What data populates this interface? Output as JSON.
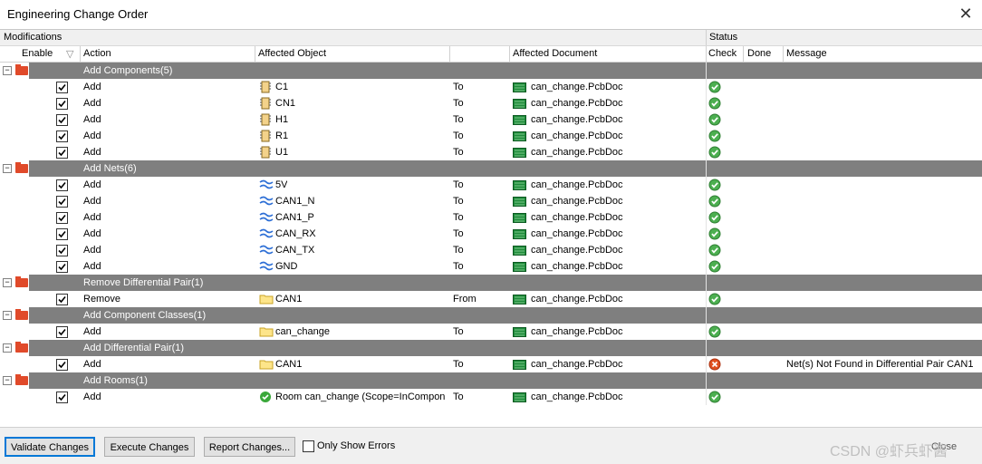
{
  "window": {
    "title": "Engineering Change Order",
    "close_icon": "close-icon"
  },
  "headers": {
    "modifications": "Modifications",
    "status": "Status",
    "enable": "Enable",
    "action": "Action",
    "affected_object": "Affected Object",
    "affected_document": "Affected Document",
    "check": "Check",
    "done": "Done",
    "message": "Message"
  },
  "groups": [
    {
      "label": "Add Components(5)",
      "rows": [
        {
          "action": "Add",
          "object": "C1",
          "object_icon": "component-icon",
          "dir": "To",
          "doc": "can_change.PcbDoc",
          "check": "ok",
          "message": ""
        },
        {
          "action": "Add",
          "object": "CN1",
          "object_icon": "component-icon",
          "dir": "To",
          "doc": "can_change.PcbDoc",
          "check": "ok",
          "message": ""
        },
        {
          "action": "Add",
          "object": "H1",
          "object_icon": "component-icon",
          "dir": "To",
          "doc": "can_change.PcbDoc",
          "check": "ok",
          "message": ""
        },
        {
          "action": "Add",
          "object": "R1",
          "object_icon": "component-icon",
          "dir": "To",
          "doc": "can_change.PcbDoc",
          "check": "ok",
          "message": ""
        },
        {
          "action": "Add",
          "object": "U1",
          "object_icon": "component-icon",
          "dir": "To",
          "doc": "can_change.PcbDoc",
          "check": "ok",
          "message": ""
        }
      ]
    },
    {
      "label": "Add Nets(6)",
      "rows": [
        {
          "action": "Add",
          "object": "5V",
          "object_icon": "net-icon",
          "dir": "To",
          "doc": "can_change.PcbDoc",
          "check": "ok",
          "message": ""
        },
        {
          "action": "Add",
          "object": "CAN1_N",
          "object_icon": "net-icon",
          "dir": "To",
          "doc": "can_change.PcbDoc",
          "check": "ok",
          "message": ""
        },
        {
          "action": "Add",
          "object": "CAN1_P",
          "object_icon": "net-icon",
          "dir": "To",
          "doc": "can_change.PcbDoc",
          "check": "ok",
          "message": ""
        },
        {
          "action": "Add",
          "object": "CAN_RX",
          "object_icon": "net-icon",
          "dir": "To",
          "doc": "can_change.PcbDoc",
          "check": "ok",
          "message": ""
        },
        {
          "action": "Add",
          "object": "CAN_TX",
          "object_icon": "net-icon",
          "dir": "To",
          "doc": "can_change.PcbDoc",
          "check": "ok",
          "message": ""
        },
        {
          "action": "Add",
          "object": "GND",
          "object_icon": "net-icon",
          "dir": "To",
          "doc": "can_change.PcbDoc",
          "check": "ok",
          "message": ""
        }
      ]
    },
    {
      "label": "Remove Differential Pair(1)",
      "rows": [
        {
          "action": "Remove",
          "object": "CAN1",
          "object_icon": "folder-icon",
          "dir": "From",
          "doc": "can_change.PcbDoc",
          "check": "ok",
          "message": ""
        }
      ]
    },
    {
      "label": "Add Component Classes(1)",
      "rows": [
        {
          "action": "Add",
          "object": "can_change",
          "object_icon": "folder-icon",
          "dir": "To",
          "doc": "can_change.PcbDoc",
          "check": "ok",
          "message": ""
        }
      ]
    },
    {
      "label": "Add Differential Pair(1)",
      "rows": [
        {
          "action": "Add",
          "object": "CAN1",
          "object_icon": "folder-icon",
          "dir": "To",
          "doc": "can_change.PcbDoc",
          "check": "error",
          "message": "Net(s) Not Found in Differential Pair CAN1"
        }
      ]
    },
    {
      "label": "Add Rooms(1)",
      "rows": [
        {
          "action": "Add",
          "object": "Room can_change (Scope=InCompon",
          "object_icon": "room-icon",
          "dir": "To",
          "doc": "can_change.PcbDoc",
          "check": "ok",
          "message": ""
        }
      ]
    }
  ],
  "footer": {
    "validate": "Validate Changes",
    "execute": "Execute Changes",
    "report": "Report Changes...",
    "only_errors": "Only Show Errors",
    "close": "Close",
    "watermark": "CSDN @虾兵虾酱"
  },
  "colors": {
    "group_bg": "#7f7f7f",
    "ok": "#3aa83a",
    "error": "#e05020",
    "folder": "#e04a2a"
  }
}
